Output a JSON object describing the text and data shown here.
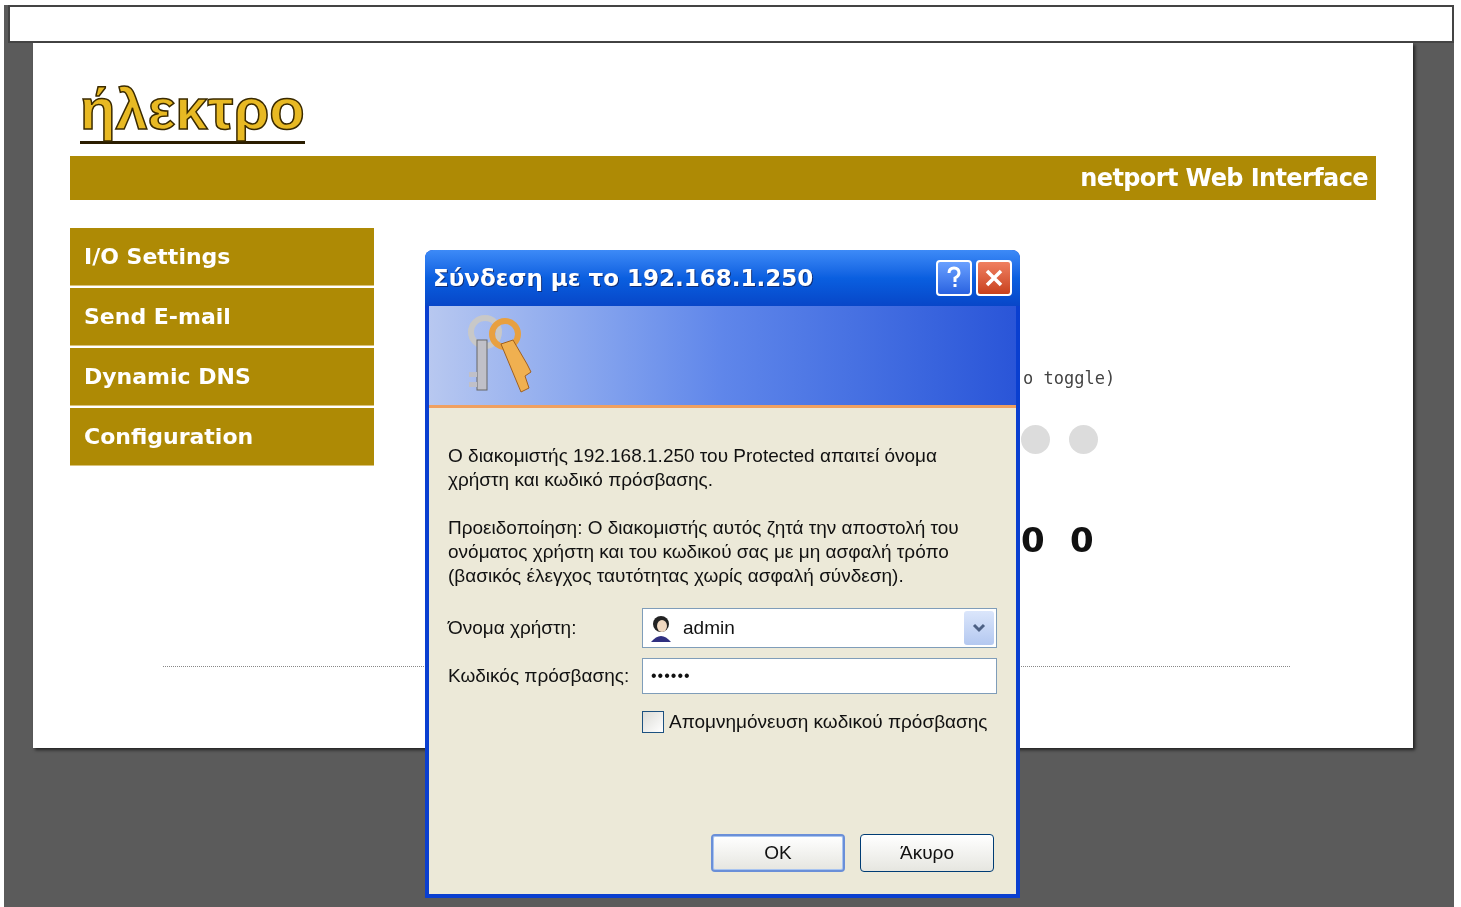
{
  "logo": {
    "text": "ήλεκτρο"
  },
  "header_bar": {
    "title": "netport Web Interface"
  },
  "nav": [
    {
      "label": "I/O Settings"
    },
    {
      "label": "Send E-mail"
    },
    {
      "label": "Dynamic DNS"
    },
    {
      "label": "Configuration"
    }
  ],
  "background_content": {
    "hint": "o toggle)",
    "indicators": [
      {
        "on": false
      },
      {
        "on": false
      }
    ],
    "counters": [
      "0",
      "0"
    ]
  },
  "dialog": {
    "title": "Σύνδεση με το 192.168.1.250",
    "message": "Ο διακομιστής 192.168.1.250 του Protected απαιτεί όνομα χρήστη και κωδικό πρόσβασης.",
    "warning": "Προειδοποίηση: Ο διακομιστής αυτός ζητά την αποστολή του ονόματος χρήστη και του κωδικού σας με μη ασφαλή τρόπο (βασικός έλεγχος ταυτότητας χωρίς ασφαλή σύνδεση).",
    "username": {
      "label": "Όνομα χρήστη:",
      "value": "admin"
    },
    "password": {
      "label": "Κωδικός πρόσβασης:",
      "value": "••••••"
    },
    "remember": {
      "label": "Απομνημόνευση κωδικού πρόσβασης",
      "checked": false
    },
    "buttons": [
      {
        "label": "OK",
        "default": true
      },
      {
        "label": "Άκυρο",
        "default": false
      }
    ]
  }
}
